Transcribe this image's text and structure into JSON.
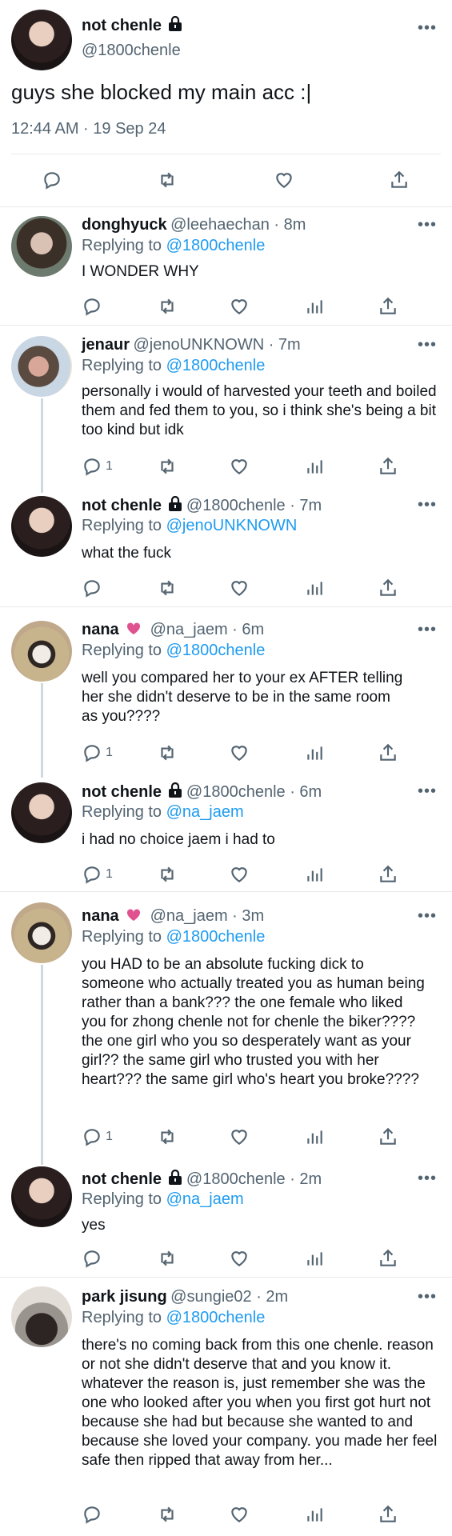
{
  "main": {
    "name": "not chenle",
    "handle": "@1800chenle",
    "text": "guys she blocked my main acc :|",
    "timestamp": "12:44 AM · 19 Sep 24"
  },
  "replies": [
    {
      "name": "donghyuck",
      "handle": "@leehaechan · 8m",
      "reply_label": "Replying to ",
      "reply_to": "@1800chenle",
      "text": "I WONDER WHY",
      "reply_count": ""
    },
    {
      "name": "jenaur",
      "handle": "@jenoUNKNOWN · 7m",
      "reply_label": "Replying to ",
      "reply_to": "@1800chenle",
      "text": "personally i would of harvested your teeth and boiled them and fed them to you, so i think she's being a bit too kind but idk",
      "reply_count": "1"
    },
    {
      "name": "not chenle",
      "handle": "@1800chenle · 7m",
      "reply_label": "Replying to ",
      "reply_to": "@jenoUNKNOWN",
      "text": "what the fuck",
      "reply_count": ""
    },
    {
      "name": "nana",
      "handle": "@na_jaem · 6m",
      "reply_label": "Replying to ",
      "reply_to": "@1800chenle",
      "text": "well you compared her to your ex AFTER telling her she didn't deserve to be in the same room as you????",
      "reply_count": "1"
    },
    {
      "name": "not chenle",
      "handle": "@1800chenle · 6m",
      "reply_label": "Replying to ",
      "reply_to": "@na_jaem",
      "text": "i had no choice jaem i had to",
      "reply_count": "1"
    },
    {
      "name": "nana",
      "handle": "@na_jaem · 3m",
      "reply_label": "Replying to ",
      "reply_to": "@1800chenle",
      "text": "you HAD to be an absolute fucking dick to someone who actually treated you as human being rather than a bank??? the one female who liked you for zhong chenle not for chenle the biker???? the one girl who you so desperately want as your girl?? the same girl who trusted you with her heart??? the same girl who's heart you broke????",
      "reply_count": "1"
    },
    {
      "name": "not chenle",
      "handle": "@1800chenle · 2m",
      "reply_label": "Replying to ",
      "reply_to": "@na_jaem",
      "text": "yes",
      "reply_count": ""
    },
    {
      "name": "park jisung",
      "handle": "@sungie02 · 2m",
      "reply_label": "Replying to ",
      "reply_to": "@1800chenle",
      "text": "there's no coming back from this one chenle. reason or not she didn't deserve that and you know it. whatever the reason is, just remember she was the one who looked after you when you first got hurt not because she had but because she wanted to and because she loved your company. you made her feel safe then ripped that away from her...",
      "reply_count": ""
    }
  ],
  "more_glyph": "•••",
  "icons": [
    "reply-icon",
    "retweet-icon",
    "like-icon",
    "analytics-icon",
    "share-icon",
    "lock-icon",
    "heart-emoji-icon"
  ],
  "colors": {
    "accent": "#1d9bf0",
    "muted": "#536471",
    "text": "#0f1419",
    "divider": "#e6e9ec",
    "emoji": "#e0528f"
  }
}
